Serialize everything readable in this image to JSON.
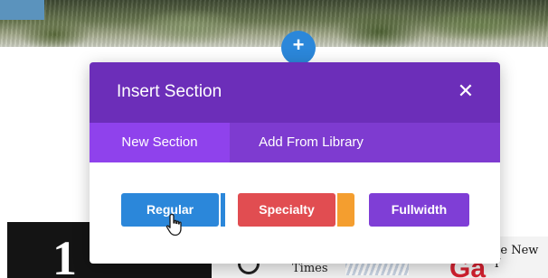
{
  "page": {
    "add_button_glyph": "+",
    "news_times_text": "Times",
    "news_nyt_text": "he New Y",
    "news_red_text": "Ga",
    "dark_block_text": "1"
  },
  "modal": {
    "title": "Insert Section",
    "close_glyph": "✕",
    "tabs": [
      {
        "label": "New Section",
        "active": true
      },
      {
        "label": "Add From Library",
        "active": false
      }
    ],
    "buttons": [
      {
        "label": "Regular",
        "color": "#2b87da"
      },
      {
        "label": "Specialty",
        "color": "#e14d51"
      },
      {
        "label": "Fullwidth",
        "color": "#7f3ed6"
      }
    ]
  },
  "colors": {
    "header": "#6c2eb9",
    "tabs_bar": "#7e3bd0",
    "active_tab": "#8f42ec",
    "add_button": "#2b87da",
    "specialty_accent": "#f49e2f"
  },
  "icons": {
    "add": "plus-icon",
    "close": "close-icon",
    "cursor": "hand-pointer-icon"
  }
}
